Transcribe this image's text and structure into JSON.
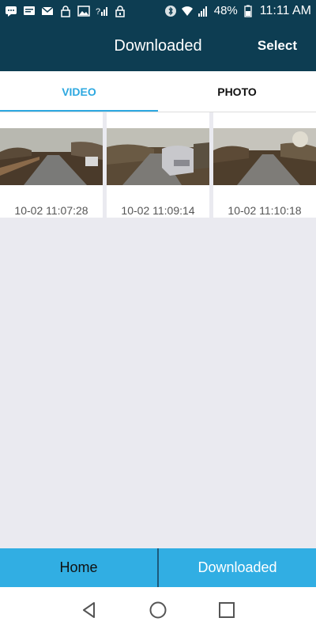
{
  "status_bar": {
    "battery": "48%",
    "time": "11:11 AM",
    "icons_left": [
      "chat-icon",
      "message-icon",
      "mail-icon",
      "lock-icon",
      "image-icon",
      "signal-question-icon",
      "lock-icon"
    ],
    "icons_right": [
      "bluetooth-icon",
      "wifi-icon",
      "signal-icon",
      "battery-icon"
    ]
  },
  "app_bar": {
    "title": "Downloaded",
    "select_label": "Select"
  },
  "tabs": [
    {
      "label": "VIDEO",
      "active": true
    },
    {
      "label": "PHOTO",
      "active": false
    }
  ],
  "items": [
    {
      "time": "10-02 11:07:28"
    },
    {
      "time": "10-02 11:09:14"
    },
    {
      "time": "10-02 11:10:18"
    }
  ],
  "bottom_nav": {
    "home_label": "Home",
    "downloaded_label": "Downloaded"
  },
  "colors": {
    "header": "#0d3d52",
    "accent": "#2da8e0",
    "bottom_nav": "#31aee3"
  }
}
